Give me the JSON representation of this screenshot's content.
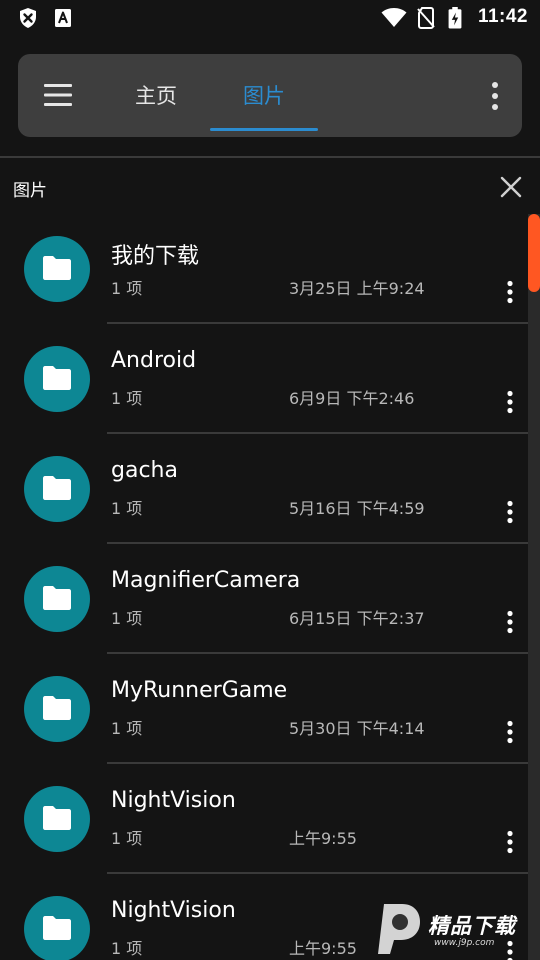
{
  "status_bar": {
    "time": "11:42",
    "icons": [
      "shield-x-icon",
      "font-a-icon",
      "wifi-icon",
      "no-sim-icon",
      "battery-charging-icon"
    ]
  },
  "app_bar": {
    "tabs": [
      {
        "label": "主页",
        "active": false
      },
      {
        "label": "图片",
        "active": true
      }
    ],
    "accent_color": "#2b8cd0"
  },
  "sheet": {
    "title": "图片",
    "close_icon": "close-icon"
  },
  "items": [
    {
      "name": "我的下载",
      "count": "1 项",
      "date": "3月25日 上午9:24"
    },
    {
      "name": "Android",
      "count": "1 项",
      "date": "6月9日 下午2:46"
    },
    {
      "name": "gacha",
      "count": "1 项",
      "date": "5月16日 下午4:59"
    },
    {
      "name": "MagnifierCamera",
      "count": "1 项",
      "date": "6月15日 下午2:37"
    },
    {
      "name": "MyRunnerGame",
      "count": "1 项",
      "date": "5月30日 下午4:14"
    },
    {
      "name": "NightVision",
      "count": "1 项",
      "date": "上午9:55"
    },
    {
      "name": "NightVision",
      "count": "1 项",
      "date": "上午9:55"
    }
  ],
  "colors": {
    "background": "#141414",
    "folder_avatar": "#0d8794",
    "scroll_thumb": "#ff5722",
    "app_bar": "#3e3e3e"
  },
  "watermark": {
    "text": "精品下载",
    "url": "www.j9p.com"
  }
}
